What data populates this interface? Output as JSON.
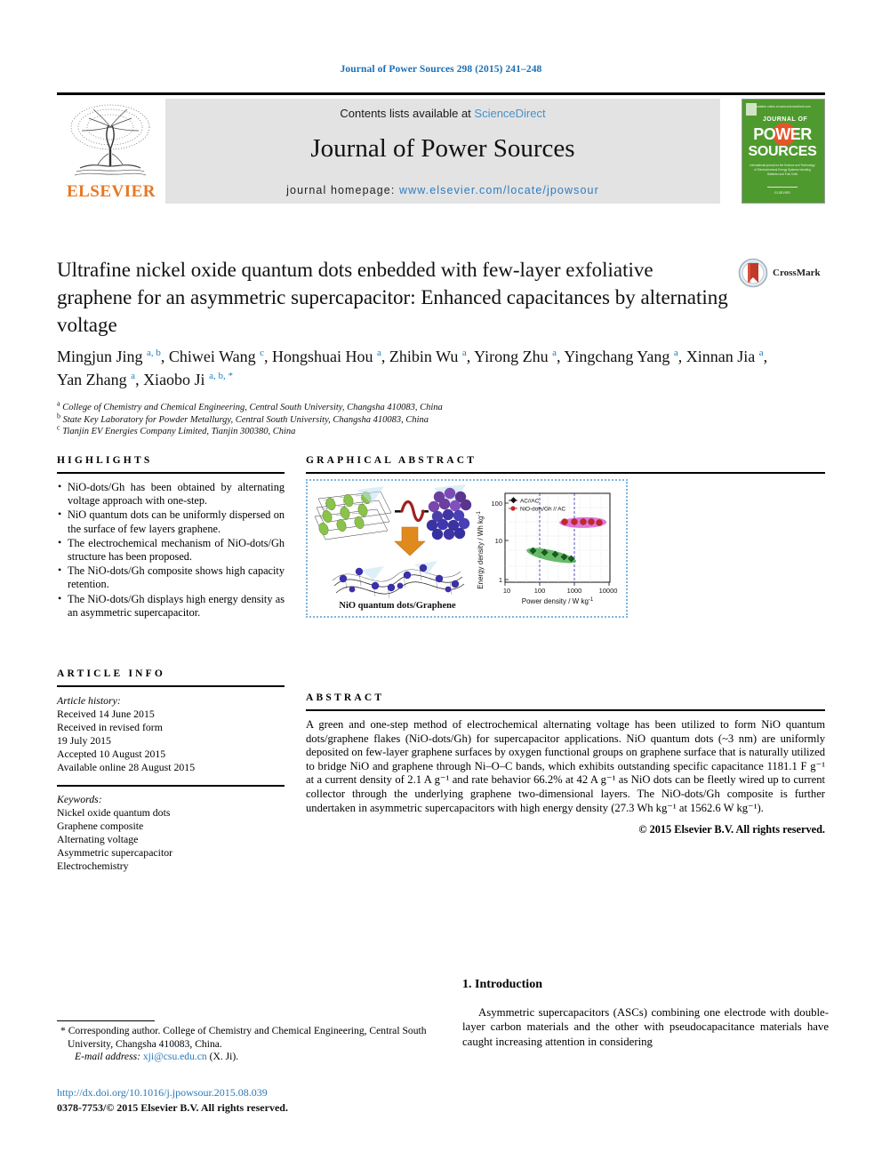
{
  "running_head": "Journal of Power Sources 298 (2015) 241–248",
  "masthead": {
    "contents_prefix": "Contents lists available at ",
    "sciencedirect": "ScienceDirect",
    "journal_title": "Journal of Power Sources",
    "homepage_prefix": "journal homepage: ",
    "homepage_url": "www.elsevier.com/locate/jpowsour",
    "publisher": "ELSEVIER",
    "cover": {
      "top_label": "JOURNAL OF",
      "word1": "POWER",
      "word2": "SOURCES",
      "blurb": "International journal on the Science and Technology of Electrochemical Energy Systems including Batteries and Fuel Cells",
      "footer": "Available online at www.sciencedirect.com"
    },
    "accent_link_color": "#4a90c4",
    "elsevier_orange": "#e87722",
    "cover_green": "#4f9a2f"
  },
  "article": {
    "title": "Ultrafine nickel oxide quantum dots enbedded with few-layer exfoliative graphene for an asymmetric supercapacitor: Enhanced capacitances by alternating voltage",
    "crossmark_label": "CrossMark",
    "authors_line1": "Mingjun Jing",
    "authors": [
      {
        "name": "Mingjun Jing",
        "marks": "a, b"
      },
      {
        "name": "Chiwei Wang",
        "marks": "c"
      },
      {
        "name": "Hongshuai Hou",
        "marks": "a"
      },
      {
        "name": "Zhibin Wu",
        "marks": "a"
      },
      {
        "name": "Yirong Zhu",
        "marks": "a"
      },
      {
        "name": "Yingchang Yang",
        "marks": "a"
      },
      {
        "name": "Xinnan Jia",
        "marks": "a"
      },
      {
        "name": "Yan Zhang",
        "marks": "a"
      },
      {
        "name": "Xiaobo Ji",
        "marks": "a, b, *"
      }
    ],
    "affiliations": [
      {
        "mark": "a",
        "text": "College of Chemistry and Chemical Engineering, Central South University, Changsha 410083, China"
      },
      {
        "mark": "b",
        "text": "State Key Laboratory for Powder Metallurgy, Central South University, Changsha 410083, China"
      },
      {
        "mark": "c",
        "text": "Tianjin EV Energies Company Limited, Tianjin 300380, China"
      }
    ]
  },
  "highlights": {
    "heading": "Highlights",
    "items": [
      "NiO-dots/Gh has been obtained by alternating voltage approach with one-step.",
      "NiO quantum dots can be uniformly dispersed on the surface of few layers graphene.",
      "The electrochemical mechanism of NiO-dots/Gh structure has been proposed.",
      "The NiO-dots/Gh composite shows high capacity retention.",
      "The NiO-dots/Gh displays high energy density as an asymmetric supercapacitor."
    ]
  },
  "article_info": {
    "heading": "Article info",
    "history_label": "Article history:",
    "history": [
      "Received 14 June 2015",
      "Received in revised form",
      "19 July 2015",
      "Accepted 10 August 2015",
      "Available online 28 August 2015"
    ],
    "keywords_label": "Keywords:",
    "keywords": [
      "Nickel oxide quantum dots",
      "Graphene composite",
      "Alternating voltage",
      "Asymmetric supercapacitor",
      "Electrochemistry"
    ]
  },
  "graphical_abstract": {
    "heading": "Graphical abstract",
    "caption": "NiO quantum dots/Graphene",
    "border_color": "#7fb4dc"
  },
  "chart_data": {
    "type": "scatter",
    "title": "",
    "xlabel": "Power density / W kg⁻¹",
    "ylabel": "Energy density / Wh kg⁻¹",
    "xscale": "log",
    "yscale": "log",
    "xlim": [
      10,
      10000
    ],
    "ylim": [
      1,
      300
    ],
    "xticks": [
      "10",
      "100",
      "1000",
      "10000"
    ],
    "yticks": [
      "1",
      "10",
      "100"
    ],
    "grid": true,
    "legend_position": "top-left",
    "series": [
      {
        "name": "AC//AC",
        "color": "#3a8f3a",
        "marker": "diamond",
        "x": [
          150,
          320,
          680,
          1500,
          2600,
          3200
        ],
        "y": [
          5.5,
          5.3,
          5.0,
          4.6,
          4.2,
          4.0
        ]
      },
      {
        "name": "NiO-dots/Gh // AC",
        "color": "#cc2a2a",
        "marker": "circle",
        "halo_color": "#d44fd4",
        "x": [
          400,
          800,
          1563,
          2400,
          3400,
          4200
        ],
        "y": [
          30,
          29,
          27.3,
          26,
          24,
          22
        ]
      }
    ]
  },
  "abstract": {
    "heading": "Abstract",
    "paragraph": "A green and one-step method of electrochemical alternating voltage has been utilized to form NiO quantum dots/graphene flakes (NiO-dots/Gh) for supercapacitor applications. NiO quantum dots (~3 nm) are uniformly deposited on few-layer graphene surfaces by oxygen functional groups on graphene surface that is naturally utilized to bridge NiO and graphene through Ni–O–C bands, which exhibits outstanding specific capacitance 1181.1 F g⁻¹ at a current density of 2.1 A g⁻¹ and rate behavior 66.2% at 42 A g⁻¹ as NiO dots can be fleetly wired up to current collector through the underlying graphene two-dimensional layers. The NiO-dots/Gh composite is further undertaken in asymmetric supercapacitors with high energy density (27.3 Wh kg⁻¹ at 1562.6 W kg⁻¹).",
    "copyright": "© 2015 Elsevier B.V. All rights reserved."
  },
  "introduction": {
    "number_title": "1. Introduction",
    "paragraph": "Asymmetric supercapacitors (ASCs) combining one electrode with double-layer carbon materials and the other with pseudocapacitance materials have caught increasing attention in considering"
  },
  "footer": {
    "corresponding_note": "* Corresponding author. College of Chemistry and Chemical Engineering, Central South University, Changsha 410083, China.",
    "email_label": "E-mail address:",
    "email": "xji@csu.edu.cn",
    "email_suffix": "(X. Ji).",
    "doi": "http://dx.doi.org/10.1016/j.jpowsour.2015.08.039",
    "issn_copyright": "0378-7753/© 2015 Elsevier B.V. All rights reserved."
  }
}
